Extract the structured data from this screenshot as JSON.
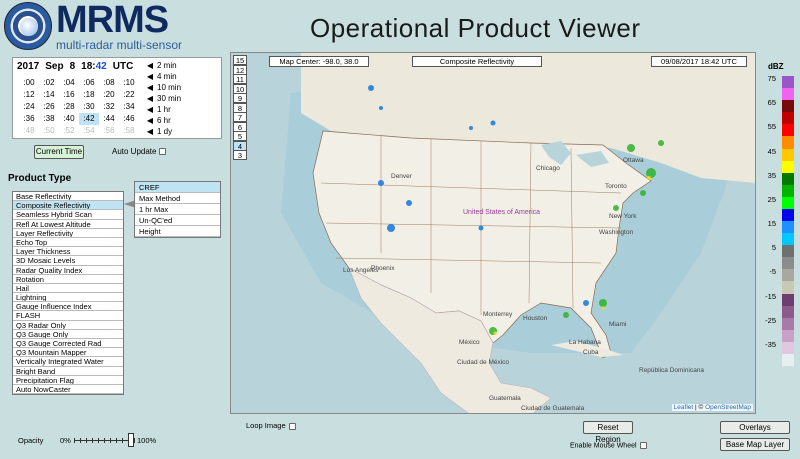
{
  "header": {
    "brand": "MRMS",
    "brand_sub": "multi-radar multi-sensor",
    "title": "Operational Product Viewer"
  },
  "time": {
    "year": "2017",
    "month": "Sep",
    "day": "8",
    "hour": "18:",
    "minute": "42",
    "zone": "UTC",
    "minutes": [
      ":00",
      ":02",
      ":04",
      ":06",
      ":08",
      ":10",
      ":12",
      ":14",
      ":16",
      ":18",
      ":20",
      ":22",
      ":24",
      ":26",
      ":28",
      ":30",
      ":32",
      ":34",
      ":36",
      ":38",
      ":40",
      ":42",
      ":44",
      ":46",
      ":48",
      ":50",
      ":52",
      ":54",
      ":56",
      ":58"
    ],
    "selected_minute": ":42",
    "steps": [
      "2 min",
      "4 min",
      "10 min",
      "30 min",
      "1 hr",
      "6 hr",
      "1 dy"
    ],
    "arrow_left": "◀",
    "arrow_right": "▶",
    "current_time_label": "Current Time",
    "auto_update_label": "Auto Update"
  },
  "product_type": {
    "title": "Product Type",
    "items": [
      "Base Reflectivity",
      "Composite Reflectivity",
      "Seamless Hybrid Scan",
      "Refl At Lowest Altitude",
      "Layer Reflectivity",
      "Echo Top",
      "Layer Thickness",
      "3D Mosaic Levels",
      "Radar Quality Index",
      "Rotation",
      "Hail",
      "Lightning",
      "Gauge Influence Index",
      "FLASH",
      "Q3 Radar Only",
      "Q3 Gauge Only",
      "Q3 Gauge Corrected Rad",
      "Q3 Mountain Mapper",
      "Vertically Integrated Water",
      "Bright Band",
      "Precipitation Flag",
      "Auto NowCaster"
    ],
    "selected": "Composite Reflectivity",
    "sub_items": [
      "CREF",
      "Max Method",
      "1 hr Max",
      "Un-QC'ed",
      "Height"
    ],
    "sub_selected": "CREF"
  },
  "opacity": {
    "label": "Opacity",
    "min_label": "0%",
    "max_label": "100%",
    "value_percent": 100
  },
  "map": {
    "center_label": "Map Center: -98.0, 38.0",
    "product_label": "Composite Reflectivity",
    "timestamp_label": "09/08/2017   18:42 UTC",
    "zoom_levels": [
      "15",
      "12",
      "11",
      "10",
      "9",
      "8",
      "7",
      "6",
      "5",
      "4",
      "3"
    ],
    "selected_zoom": "4",
    "cities": [
      "Ottawa",
      "Toronto",
      "New York",
      "Washington",
      "Chicago",
      "Denver",
      "Los Angeles",
      "Phoenix",
      "Monterrey",
      "Houston",
      "Miami",
      "La Habana",
      "Cuba",
      "México",
      "Ciudad de México",
      "Guatemala",
      "República Dominicana",
      "Ciudad de Guatemala",
      "United States of America"
    ],
    "attribution_a": "Leaflet",
    "attribution_sep": " | © ",
    "attribution_b": "OpenStreetMap"
  },
  "legend": {
    "title": "dBZ",
    "labels": [
      "75",
      "65",
      "55",
      "45",
      "35",
      "25",
      "15",
      "5",
      "-5",
      "-15",
      "-25",
      "-35"
    ],
    "colors": [
      "#9a55c9",
      "#f062f0",
      "#7a0a0a",
      "#c00000",
      "#ff0000",
      "#ff8c00",
      "#ffc800",
      "#ffff00",
      "#007a00",
      "#00b400",
      "#00ff00",
      "#0000f0",
      "#1e90ff",
      "#00c8ff",
      "#707070",
      "#8c8c8c",
      "#a8a8a0",
      "#c8c8b4",
      "#6e3f6e",
      "#8c5a8c",
      "#a87aa8",
      "#c8a0c8",
      "#e0c8e0",
      "#e6f0f0"
    ]
  },
  "controls": {
    "loop_image_label": "Loop Image",
    "reset_region_label": "Reset Region",
    "mouse_wheel_label": "Enable Mouse Wheel",
    "overlays_label": "Overlays",
    "base_map_label": "Base Map Layer"
  }
}
